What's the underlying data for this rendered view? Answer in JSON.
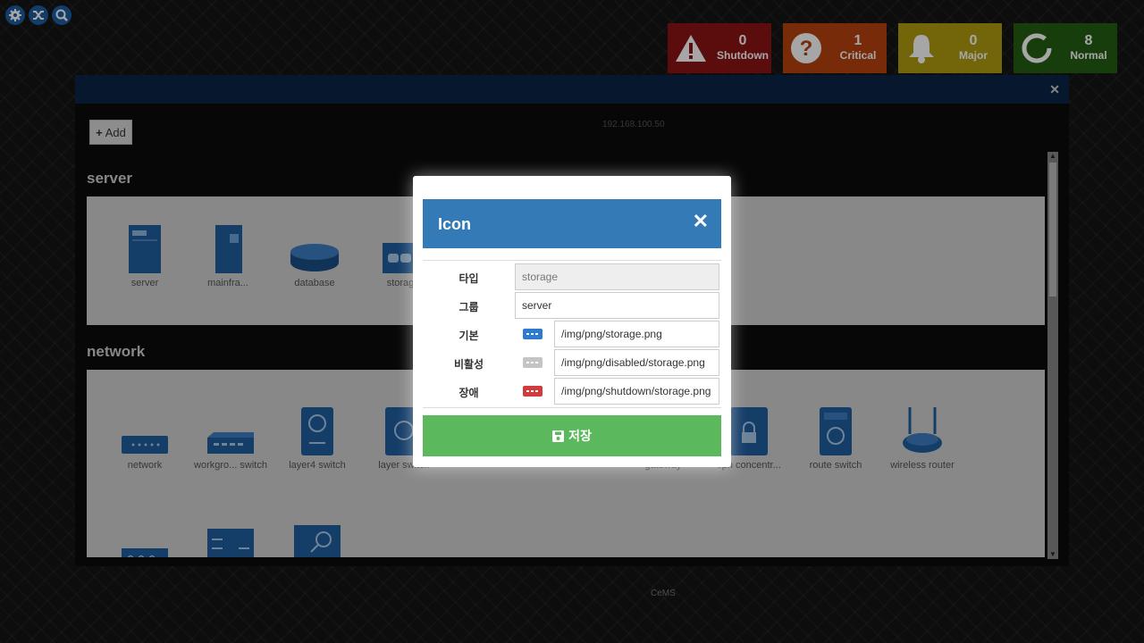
{
  "toolbar": {
    "icons": [
      "gear-icon",
      "shuffle-icon",
      "search-icon"
    ]
  },
  "status": [
    {
      "count": "0",
      "label": "Shutdown",
      "color": "#8c1515",
      "icon": "warning-icon"
    },
    {
      "count": "1",
      "label": "Critical",
      "color": "#b8420f",
      "icon": "question-icon"
    },
    {
      "count": "0",
      "label": "Major",
      "color": "#b19b0e",
      "icon": "bell-icon"
    },
    {
      "count": "8",
      "label": "Normal",
      "color": "#265e13",
      "icon": "ring-icon"
    }
  ],
  "background": {
    "add_label": "Add",
    "ghost_ip": "192.168.100.50",
    "ghost_cems": "CeMS",
    "sections": [
      {
        "title": "server",
        "items": [
          "server",
          "mainfra...",
          "database",
          "storag"
        ]
      },
      {
        "title": "network",
        "items": [
          "network",
          "workgro... switch",
          "layer4 switch",
          "layer switch",
          "gateway",
          "vpn concentr...",
          "route switch",
          "wireless router"
        ]
      }
    ]
  },
  "modal": {
    "title": "Icon",
    "fields": {
      "type": {
        "label": "타입",
        "value": "storage"
      },
      "group": {
        "label": "그룹",
        "value": "server"
      },
      "default": {
        "label": "기본",
        "value": "/img/png/storage.png"
      },
      "disabled": {
        "label": "비활성",
        "value": "/img/png/disabled/storage.png"
      },
      "fault": {
        "label": "장애",
        "value": "/img/png/shutdown/storage.png"
      }
    },
    "save_label": "저장"
  },
  "colors": {
    "accent": "#337ab7",
    "save": "#5cb85c",
    "icon_blue": "#1d5fa0"
  }
}
